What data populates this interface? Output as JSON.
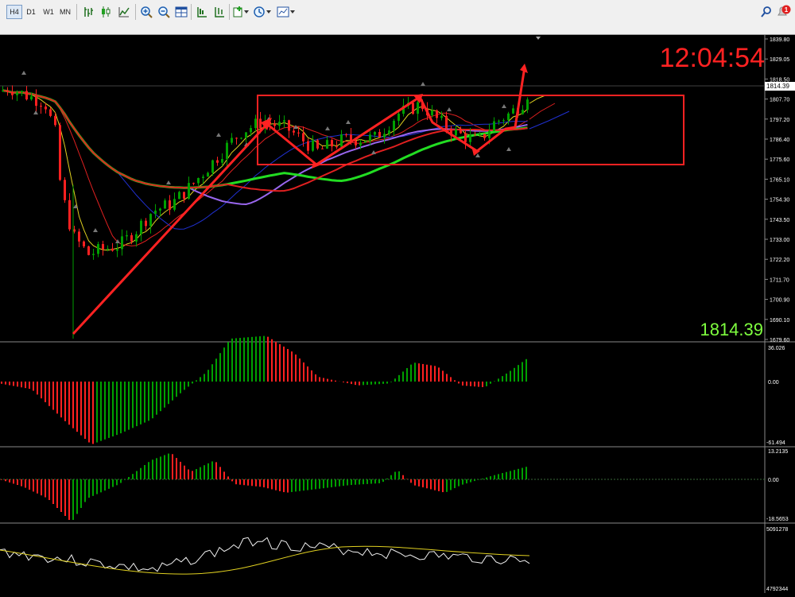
{
  "toolbar": {
    "timeframes": [
      "H4",
      "D1",
      "W1",
      "MN"
    ],
    "active_timeframe": "H4",
    "icons": [
      "bar-chart-icon",
      "candle-chart-icon",
      "line-chart-icon",
      "zoom-in-icon",
      "zoom-out-icon",
      "tile-windows-icon",
      "cursor-icon",
      "crosshair-icon",
      "indicators-icon",
      "periods-icon",
      "templates-icon",
      "search-icon",
      "alerts-icon"
    ],
    "alerts_count": "1"
  },
  "chart": {
    "clock": "12:04:54",
    "last_price": "1814.39",
    "price_tag": "1814.39",
    "price_scale": [
      "1839.80",
      "1829.05",
      "1818.50",
      "1807.70",
      "1797.20",
      "1786.40",
      "1775.60",
      "1765.10",
      "1754.30",
      "1743.50",
      "1733.00",
      "1722.20",
      "1711.70",
      "1700.90",
      "1690.10",
      "1679.60"
    ],
    "colors": {
      "bull": "#00a000",
      "bear": "#ff2020",
      "ma_green": "#22dd22",
      "ma_red": "#e02020",
      "ma_purple": "#9966ee",
      "ma_blue": "#2030d0",
      "ma_yellow": "#e0d020",
      "annotation": "#ff2222",
      "clock": "#ff2222",
      "price_text": "#7fff3f"
    }
  },
  "macd": {
    "max": "36.026",
    "zero": "0.00",
    "min": "-61.494"
  },
  "osma": {
    "max": "13.2135",
    "zero": "0.00",
    "min": "-18.5653"
  },
  "volume": {
    "max": "5091278",
    "min": "4792344"
  }
}
